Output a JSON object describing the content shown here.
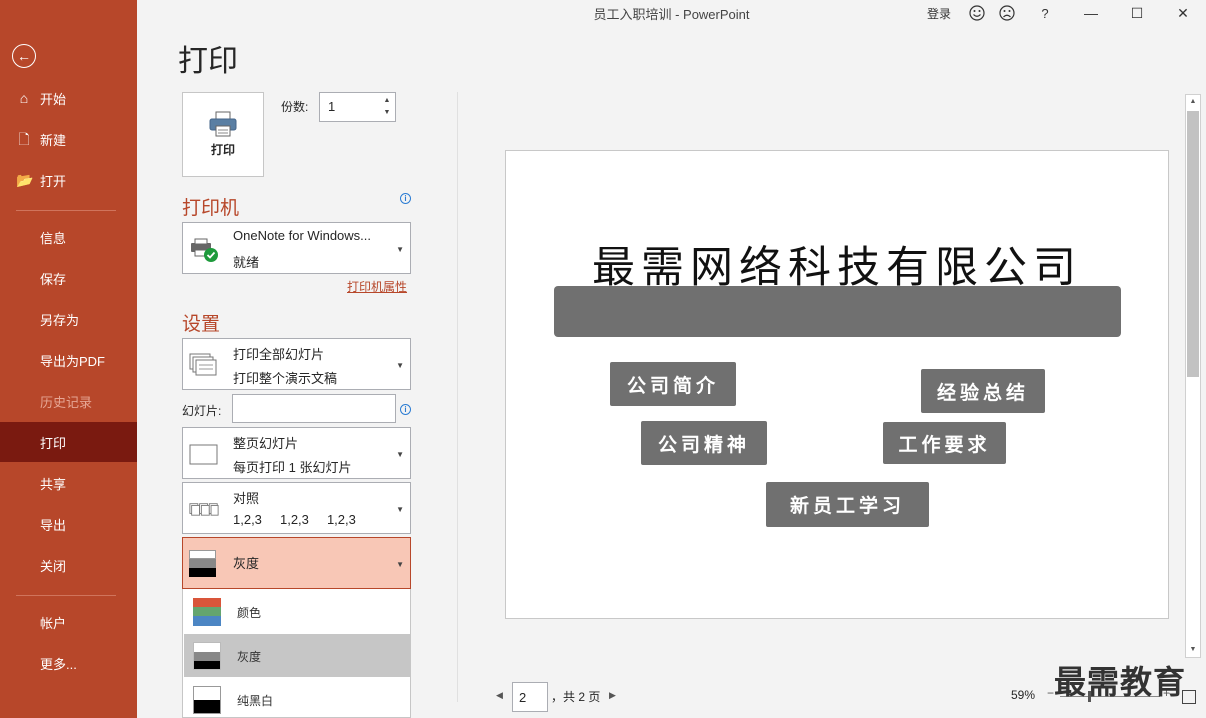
{
  "window": {
    "title": "员工入职培训  -  PowerPoint",
    "signin": "登录",
    "help": "?",
    "minimize": "—",
    "maximize": "☐",
    "close": "✕"
  },
  "sidebar": {
    "back": "←",
    "items": [
      {
        "label": "开始",
        "icon": "⌂"
      },
      {
        "label": "新建",
        "icon": "🗋"
      },
      {
        "label": "打开",
        "icon": "📂"
      },
      {
        "label": "信息"
      },
      {
        "label": "保存"
      },
      {
        "label": "另存为"
      },
      {
        "label": "导出为PDF"
      },
      {
        "label": "历史记录"
      },
      {
        "label": "打印"
      },
      {
        "label": "共享"
      },
      {
        "label": "导出"
      },
      {
        "label": "关闭"
      },
      {
        "label": "帐户"
      },
      {
        "label": "更多..."
      }
    ]
  },
  "page_title": "打印",
  "print": {
    "button_label": "打印",
    "copies_label": "份数:",
    "copies_value": "1"
  },
  "printer": {
    "heading": "打印机",
    "name": "OneNote for Windows...",
    "status": "就绪",
    "properties_link": "打印机属性"
  },
  "settings": {
    "heading": "设置",
    "range": {
      "line1": "打印全部幻灯片",
      "line2": "打印整个演示文稿"
    },
    "slides_label": "幻灯片:",
    "slides_value": "",
    "layout": {
      "line1": "整页幻灯片",
      "line2": "每页打印 1 张幻灯片"
    },
    "collate": {
      "line1": "对照",
      "line2": "1,2,3     1,2,3     1,2,3"
    },
    "color": {
      "selected": "灰度"
    },
    "color_options": [
      "颜色",
      "灰度",
      "纯黑白"
    ]
  },
  "preview": {
    "slide_title": "最需网络科技有限公司",
    "boxes": [
      "公司简介",
      "经验总结",
      "公司精神",
      "工作要求",
      "新员工学习"
    ]
  },
  "pager": {
    "current": "2",
    "total": "，共 2 页",
    "zoom": "59%",
    "zoom_minus": "−",
    "zoom_plus": "+"
  },
  "watermark": "最需教育"
}
